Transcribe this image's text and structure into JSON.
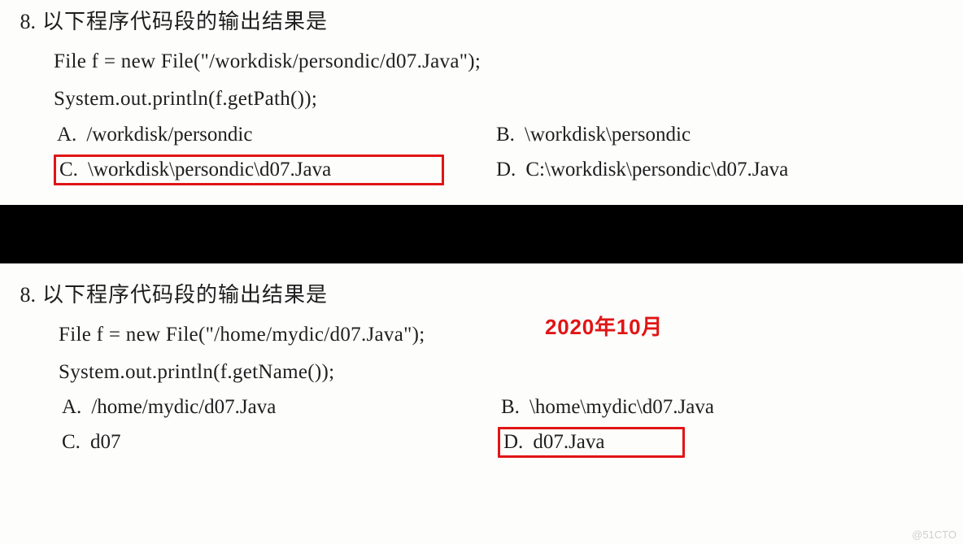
{
  "q1": {
    "number": "8.",
    "prompt": "以下程序代码段的输出结果是",
    "code_line1": "File f = new File(\"/workdisk/persondic/d07.Java\");",
    "code_line2": "System.out.println(f.getPath());",
    "opt_a_label": "A.",
    "opt_a_text": "/workdisk/persondic",
    "opt_b_label": "B.",
    "opt_b_text": "\\workdisk\\persondic",
    "opt_c_label": "C.",
    "opt_c_text": "\\workdisk\\persondic\\d07.Java",
    "opt_d_label": "D.",
    "opt_d_text": "C:\\workdisk\\persondic\\d07.Java"
  },
  "q2": {
    "number": "8.",
    "prompt": "以下程序代码段的输出结果是",
    "code_line1": "File f = new File(\"/home/mydic/d07.Java\");",
    "code_line2": "System.out.println(f.getName());",
    "opt_a_label": "A.",
    "opt_a_text": "/home/mydic/d07.Java",
    "opt_b_label": "B.",
    "opt_b_text": "\\home\\mydic\\d07.Java",
    "opt_c_label": "C.",
    "opt_c_text": "d07",
    "opt_d_label": "D.",
    "opt_d_text": "d07.Java",
    "note": "2020年10月"
  },
  "watermark": "@51CTO",
  "colors": {
    "accent_red": "#e01515"
  }
}
